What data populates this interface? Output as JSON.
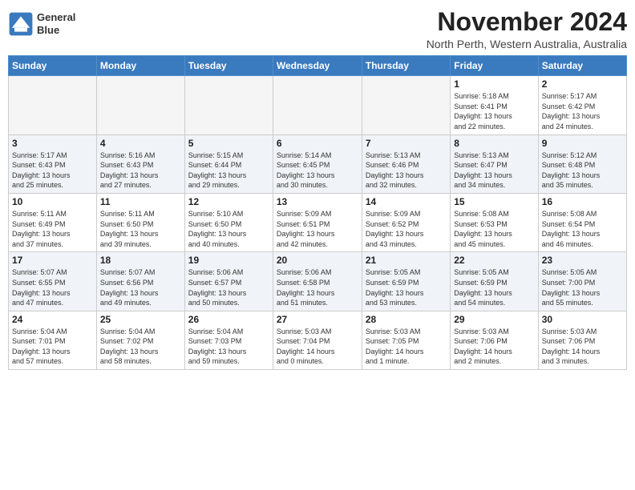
{
  "header": {
    "logo_line1": "General",
    "logo_line2": "Blue",
    "month_title": "November 2024",
    "subtitle": "North Perth, Western Australia, Australia"
  },
  "weekdays": [
    "Sunday",
    "Monday",
    "Tuesday",
    "Wednesday",
    "Thursday",
    "Friday",
    "Saturday"
  ],
  "weeks": [
    [
      {
        "day": "",
        "info": ""
      },
      {
        "day": "",
        "info": ""
      },
      {
        "day": "",
        "info": ""
      },
      {
        "day": "",
        "info": ""
      },
      {
        "day": "",
        "info": ""
      },
      {
        "day": "1",
        "info": "Sunrise: 5:18 AM\nSunset: 6:41 PM\nDaylight: 13 hours\nand 22 minutes."
      },
      {
        "day": "2",
        "info": "Sunrise: 5:17 AM\nSunset: 6:42 PM\nDaylight: 13 hours\nand 24 minutes."
      }
    ],
    [
      {
        "day": "3",
        "info": "Sunrise: 5:17 AM\nSunset: 6:43 PM\nDaylight: 13 hours\nand 25 minutes."
      },
      {
        "day": "4",
        "info": "Sunrise: 5:16 AM\nSunset: 6:43 PM\nDaylight: 13 hours\nand 27 minutes."
      },
      {
        "day": "5",
        "info": "Sunrise: 5:15 AM\nSunset: 6:44 PM\nDaylight: 13 hours\nand 29 minutes."
      },
      {
        "day": "6",
        "info": "Sunrise: 5:14 AM\nSunset: 6:45 PM\nDaylight: 13 hours\nand 30 minutes."
      },
      {
        "day": "7",
        "info": "Sunrise: 5:13 AM\nSunset: 6:46 PM\nDaylight: 13 hours\nand 32 minutes."
      },
      {
        "day": "8",
        "info": "Sunrise: 5:13 AM\nSunset: 6:47 PM\nDaylight: 13 hours\nand 34 minutes."
      },
      {
        "day": "9",
        "info": "Sunrise: 5:12 AM\nSunset: 6:48 PM\nDaylight: 13 hours\nand 35 minutes."
      }
    ],
    [
      {
        "day": "10",
        "info": "Sunrise: 5:11 AM\nSunset: 6:49 PM\nDaylight: 13 hours\nand 37 minutes."
      },
      {
        "day": "11",
        "info": "Sunrise: 5:11 AM\nSunset: 6:50 PM\nDaylight: 13 hours\nand 39 minutes."
      },
      {
        "day": "12",
        "info": "Sunrise: 5:10 AM\nSunset: 6:50 PM\nDaylight: 13 hours\nand 40 minutes."
      },
      {
        "day": "13",
        "info": "Sunrise: 5:09 AM\nSunset: 6:51 PM\nDaylight: 13 hours\nand 42 minutes."
      },
      {
        "day": "14",
        "info": "Sunrise: 5:09 AM\nSunset: 6:52 PM\nDaylight: 13 hours\nand 43 minutes."
      },
      {
        "day": "15",
        "info": "Sunrise: 5:08 AM\nSunset: 6:53 PM\nDaylight: 13 hours\nand 45 minutes."
      },
      {
        "day": "16",
        "info": "Sunrise: 5:08 AM\nSunset: 6:54 PM\nDaylight: 13 hours\nand 46 minutes."
      }
    ],
    [
      {
        "day": "17",
        "info": "Sunrise: 5:07 AM\nSunset: 6:55 PM\nDaylight: 13 hours\nand 47 minutes."
      },
      {
        "day": "18",
        "info": "Sunrise: 5:07 AM\nSunset: 6:56 PM\nDaylight: 13 hours\nand 49 minutes."
      },
      {
        "day": "19",
        "info": "Sunrise: 5:06 AM\nSunset: 6:57 PM\nDaylight: 13 hours\nand 50 minutes."
      },
      {
        "day": "20",
        "info": "Sunrise: 5:06 AM\nSunset: 6:58 PM\nDaylight: 13 hours\nand 51 minutes."
      },
      {
        "day": "21",
        "info": "Sunrise: 5:05 AM\nSunset: 6:59 PM\nDaylight: 13 hours\nand 53 minutes."
      },
      {
        "day": "22",
        "info": "Sunrise: 5:05 AM\nSunset: 6:59 PM\nDaylight: 13 hours\nand 54 minutes."
      },
      {
        "day": "23",
        "info": "Sunrise: 5:05 AM\nSunset: 7:00 PM\nDaylight: 13 hours\nand 55 minutes."
      }
    ],
    [
      {
        "day": "24",
        "info": "Sunrise: 5:04 AM\nSunset: 7:01 PM\nDaylight: 13 hours\nand 57 minutes."
      },
      {
        "day": "25",
        "info": "Sunrise: 5:04 AM\nSunset: 7:02 PM\nDaylight: 13 hours\nand 58 minutes."
      },
      {
        "day": "26",
        "info": "Sunrise: 5:04 AM\nSunset: 7:03 PM\nDaylight: 13 hours\nand 59 minutes."
      },
      {
        "day": "27",
        "info": "Sunrise: 5:03 AM\nSunset: 7:04 PM\nDaylight: 14 hours\nand 0 minutes."
      },
      {
        "day": "28",
        "info": "Sunrise: 5:03 AM\nSunset: 7:05 PM\nDaylight: 14 hours\nand 1 minute."
      },
      {
        "day": "29",
        "info": "Sunrise: 5:03 AM\nSunset: 7:06 PM\nDaylight: 14 hours\nand 2 minutes."
      },
      {
        "day": "30",
        "info": "Sunrise: 5:03 AM\nSunset: 7:06 PM\nDaylight: 14 hours\nand 3 minutes."
      }
    ]
  ]
}
